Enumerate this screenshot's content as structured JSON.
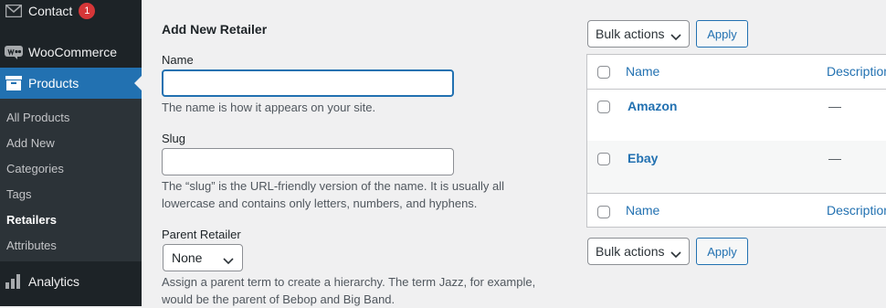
{
  "sidebar": {
    "contact": {
      "label": "Contact",
      "badge": "1"
    },
    "woocommerce": {
      "label": "WooCommerce"
    },
    "products": {
      "label": "Products"
    },
    "submenu": [
      "All Products",
      "Add New",
      "Categories",
      "Tags",
      "Retailers",
      "Attributes"
    ],
    "analytics": {
      "label": "Analytics"
    }
  },
  "form": {
    "title": "Add New Retailer",
    "name_label": "Name",
    "name_value": "",
    "name_desc": "The name is how it appears on your site.",
    "slug_label": "Slug",
    "slug_value": "",
    "slug_desc_line1": "The “slug” is the URL-friendly version of the name. It is usually all",
    "slug_desc_line2": "lowercase and contains only letters, numbers, and hyphens.",
    "parent_label": "Parent Retailer",
    "parent_selected": "None",
    "parent_desc_line1": "Assign a parent term to create a hierarchy. The term Jazz, for example,",
    "parent_desc_line2": "would be the parent of Bebop and Big Band."
  },
  "bulk": {
    "top_label": "Bulk actions",
    "bottom_label": "Bulk actions",
    "apply_label": "Apply"
  },
  "table": {
    "header": {
      "name": "Name",
      "description": "Description"
    },
    "rows": [
      {
        "name": "Amazon",
        "description": "—"
      },
      {
        "name": "Ebay",
        "description": "—"
      }
    ],
    "footer": {
      "name": "Name",
      "description": "Description"
    }
  },
  "icons": {
    "contact": "envelope-icon",
    "woocommerce": "woocommerce-bubble-icon",
    "products": "archive-box-icon",
    "analytics": "bar-chart-icon",
    "chevron": "chevron-down-icon"
  },
  "colors": {
    "accent": "#2271b1",
    "sidebar": "#1d2327",
    "submenu": "#2c3338",
    "badge": "#d63638"
  }
}
